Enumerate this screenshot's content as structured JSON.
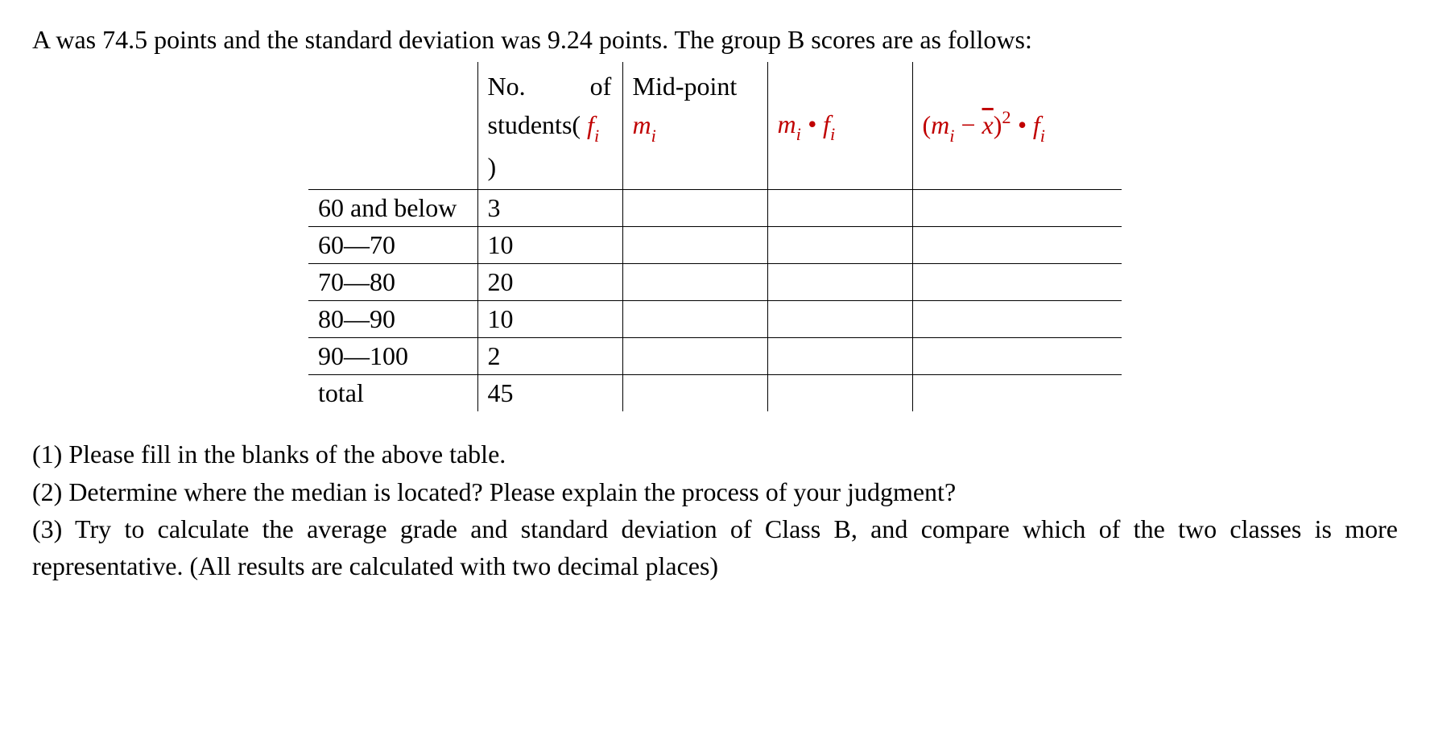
{
  "intro_text": "A was 74.5 points and the standard deviation was 9.24 points. The group B scores are as follows:",
  "table": {
    "header": {
      "col1": "",
      "col2_prefix": "No.",
      "col2_of": "of",
      "col2_students_prefix": "students(",
      "col2_fi_letter": "f",
      "col2_fi_sub": "i",
      "col2_students_suffix": ")",
      "col3_line1": "Mid-point",
      "col3_m_letter": "m",
      "col3_m_sub": "i",
      "col4_m_letter": "m",
      "col4_m_sub": "i",
      "col4_dot": " • ",
      "col4_f_letter": "f",
      "col4_f_sub": "i",
      "col5_open": "(",
      "col5_m_letter": "m",
      "col5_m_sub": "i",
      "col5_minus": " − ",
      "col5_xbar": "x",
      "col5_close": ")",
      "col5_sq": "2",
      "col5_dot": " • ",
      "col5_f_letter": "f",
      "col5_f_sub": "i"
    },
    "rows": [
      {
        "label": "60 and below",
        "freq": "3",
        "mid": "",
        "mf": "",
        "sqf": ""
      },
      {
        "label": "60—70",
        "freq": "10",
        "mid": "",
        "mf": "",
        "sqf": ""
      },
      {
        "label": "70—80",
        "freq": "20",
        "mid": "",
        "mf": "",
        "sqf": ""
      },
      {
        "label": "80—90",
        "freq": "10",
        "mid": "",
        "mf": "",
        "sqf": ""
      },
      {
        "label": "90—100",
        "freq": "2",
        "mid": "",
        "mf": "",
        "sqf": ""
      },
      {
        "label": "total",
        "freq": "45",
        "mid": "",
        "mf": "",
        "sqf": ""
      }
    ]
  },
  "questions": {
    "q1": "(1) Please fill in the blanks of the above table.",
    "q2": "(2) Determine where the median is located? Please explain the process of your judgment?",
    "q3": "(3) Try to calculate the average grade and standard deviation of Class B, and compare which of the two classes is more representative. (All results are calculated with two decimal places)"
  }
}
